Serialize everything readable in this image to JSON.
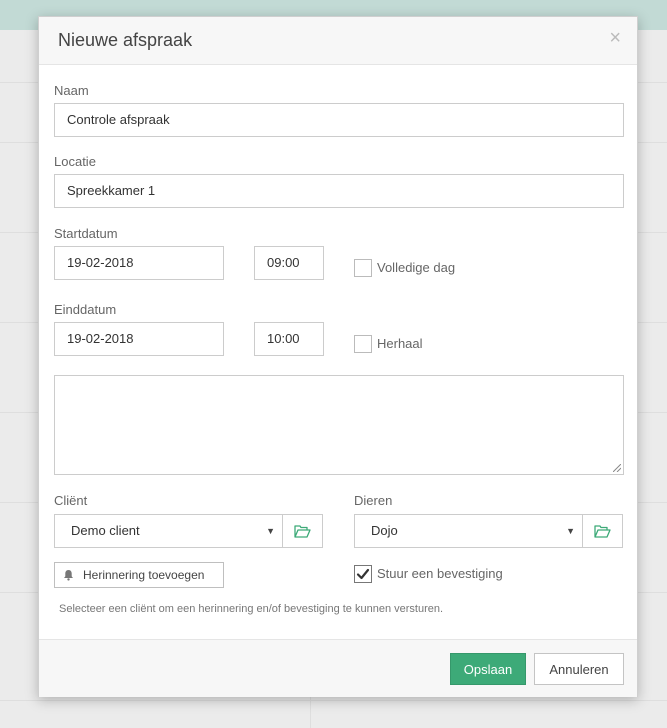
{
  "dialog": {
    "title": "Nieuwe afspraak",
    "close_label": "×"
  },
  "form": {
    "name_label": "Naam",
    "name_value": "Controle afspraak",
    "location_label": "Locatie",
    "location_value": "Spreekkamer 1",
    "start_label": "Startdatum",
    "start_date": "19-02-2018",
    "start_time": "09:00",
    "all_day_label": "Volledige dag",
    "all_day_checked": false,
    "end_label": "Einddatum",
    "end_date": "19-02-2018",
    "end_time": "10:00",
    "repeat_label": "Herhaal",
    "repeat_checked": false,
    "notes_value": "",
    "client_label": "Cliënt",
    "client_value": "Demo client",
    "animals_label": "Dieren",
    "animals_value": "Dojo",
    "reminder_button": "Herinnering toevoegen",
    "confirm_label": "Stuur een bevestiging",
    "confirm_checked": true,
    "help_text": "Selecteer een cliënt om een herinnering en/of bevestiging te kunnen versturen."
  },
  "footer": {
    "save_label": "Opslaan",
    "cancel_label": "Annuleren"
  },
  "colors": {
    "accent": "#3daa78",
    "folder_icon": "#3daa78"
  }
}
